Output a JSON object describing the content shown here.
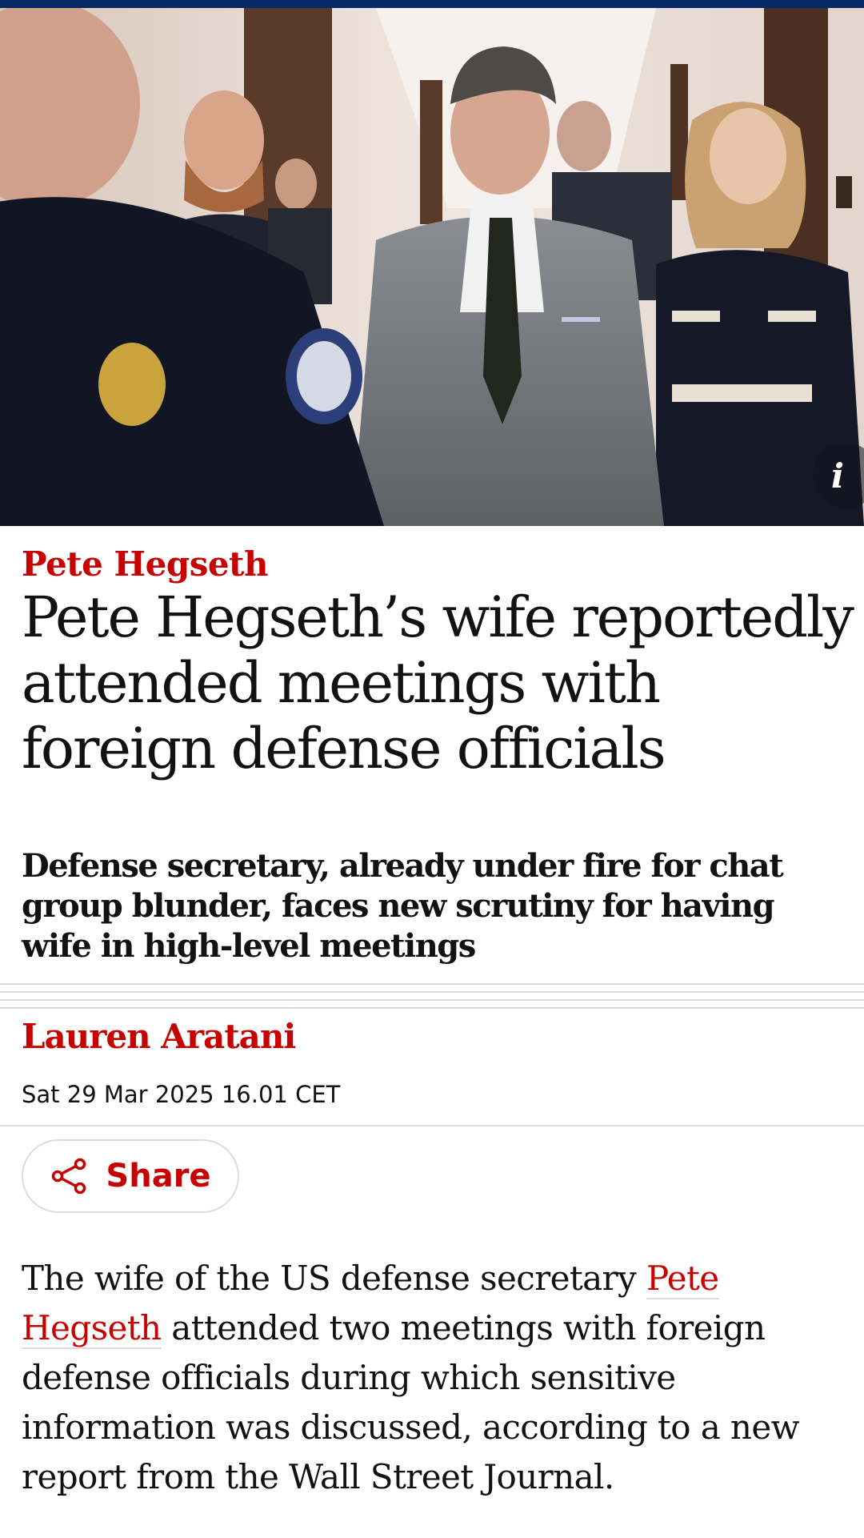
{
  "hero": {
    "info_icon": "info-icon",
    "info_glyph": "i"
  },
  "article": {
    "kicker": "Pete Hegseth",
    "headline": "Pete Hegseth’s wife reportedly attended meetings with foreign defense officials",
    "standfirst": "Defense secretary, already under fire for chat group blunder, faces new scrutiny for having wife in high-level meetings",
    "byline": "Lauren Aratani",
    "dateline": "Sat 29 Mar 2025 16.01 CET",
    "share_label": "Share",
    "share_icon": "share-icon",
    "body": {
      "before_link": "The wife of the US defense secretary ",
      "link_text": "Pete Hegseth",
      "after_link": " attended two meetings with foreign defense officials during which sensitive information was discussed, according to a new report from the Wall Street Journal."
    }
  },
  "colors": {
    "accent_red": "#c70000",
    "top_bar": "#052962",
    "text": "#121212",
    "rule": "#dcdcdc"
  }
}
